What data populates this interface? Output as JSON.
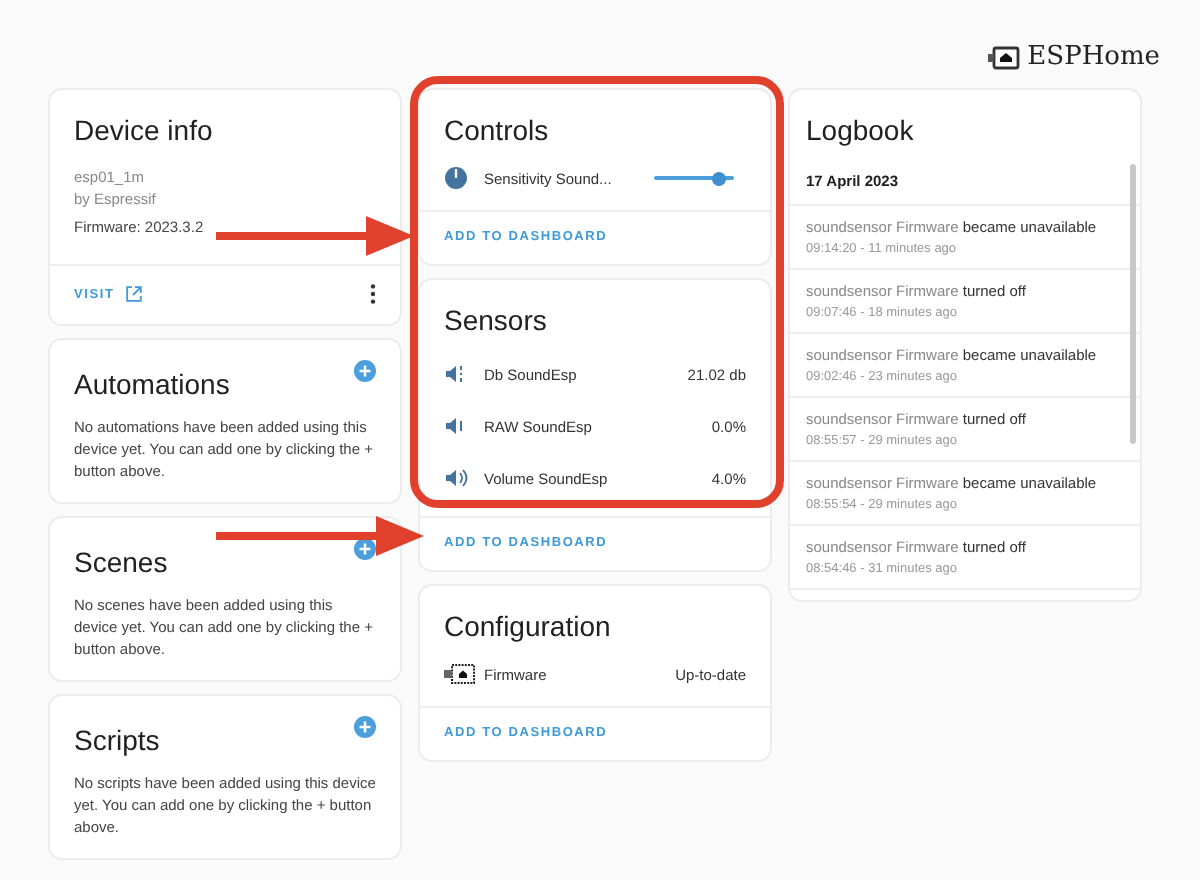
{
  "header": {
    "logo": "ESPHome"
  },
  "device_info": {
    "title": "Device info",
    "model": "esp01_1m",
    "manufacturer": "by Espressif",
    "firmware": "Firmware: 2023.3.2",
    "link": "VISIT"
  },
  "info_cards": [
    {
      "title": "Automations",
      "text": "No automations have been added using this device yet. You can add one by clicking the + button above."
    },
    {
      "title": "Scenes",
      "text": "No scenes have been added using this device yet. You can add one by clicking the + button above."
    },
    {
      "title": "Scripts",
      "text": "No scripts have been added using this device yet. You can add one by clicking the + button above."
    }
  ],
  "entity_cards": [
    {
      "title": "Controls",
      "rows": [
        {
          "kind": "slider",
          "name": "Sensitivity Sound...",
          "level": 0.82
        }
      ],
      "action": "ADD TO DASHBOARD"
    },
    {
      "title": "Sensors",
      "rows": [
        {
          "kind": "sensor",
          "name": "Db SoundEsp",
          "value": "21.02 db"
        },
        {
          "kind": "sensor",
          "name": "RAW SoundEsp",
          "value": "0.0%"
        },
        {
          "kind": "sensor",
          "name": "Volume SoundEsp",
          "value": "4.0%"
        }
      ],
      "action": "ADD TO DASHBOARD"
    },
    {
      "title": "Configuration",
      "rows": [
        {
          "kind": "firmware",
          "name": "Firmware",
          "value": "Up-to-date"
        }
      ],
      "action": "ADD TO DASHBOARD"
    }
  ],
  "logbook": {
    "title": "Logbook",
    "date": "17 April 2023",
    "entries": [
      {
        "entity": "soundsensor Firmware",
        "message": "became unavailable",
        "time": "09:14:20 - 11 minutes ago"
      },
      {
        "entity": "soundsensor Firmware",
        "message": "turned off",
        "time": "09:07:46 - 18 minutes ago"
      },
      {
        "entity": "soundsensor Firmware",
        "message": "became unavailable",
        "time": "09:02:46 - 23 minutes ago"
      },
      {
        "entity": "soundsensor Firmware",
        "message": "turned off",
        "time": "08:55:57 - 29 minutes ago"
      },
      {
        "entity": "soundsensor Firmware",
        "message": "became unavailable",
        "time": "08:55:54 - 29 minutes ago"
      },
      {
        "entity": "soundsensor Firmware",
        "message": "turned off",
        "time": "08:54:46 - 31 minutes ago"
      }
    ]
  }
}
